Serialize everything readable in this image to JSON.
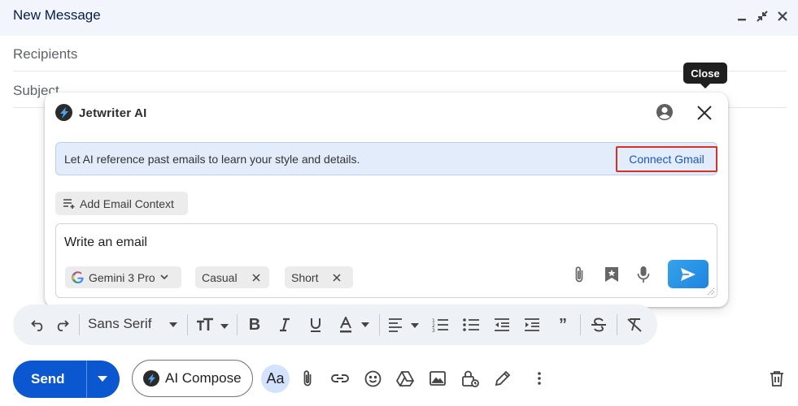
{
  "window": {
    "title": "New Message"
  },
  "fields": {
    "recipients": "Recipients",
    "subject": "Subject"
  },
  "tooltip": {
    "text": "Close"
  },
  "popup": {
    "title": "Jetwriter AI",
    "banner_text": "Let AI reference past emails to learn your style and details.",
    "connect_label": "Connect Gmail",
    "context_label": "Add Email Context",
    "prompt_text": "Write an email",
    "chips": {
      "model": "Gemini 3 Pro",
      "tone": "Casual",
      "length": "Short"
    }
  },
  "toolbar": {
    "font": "Sans Serif"
  },
  "bottom": {
    "send_label": "Send",
    "ai_compose_label": "AI Compose",
    "format_label": "Aa"
  },
  "colors": {
    "send_blue": "#0b57d0",
    "connect_highlight": "#d93025",
    "banner_bg": "#e2ecfb"
  }
}
